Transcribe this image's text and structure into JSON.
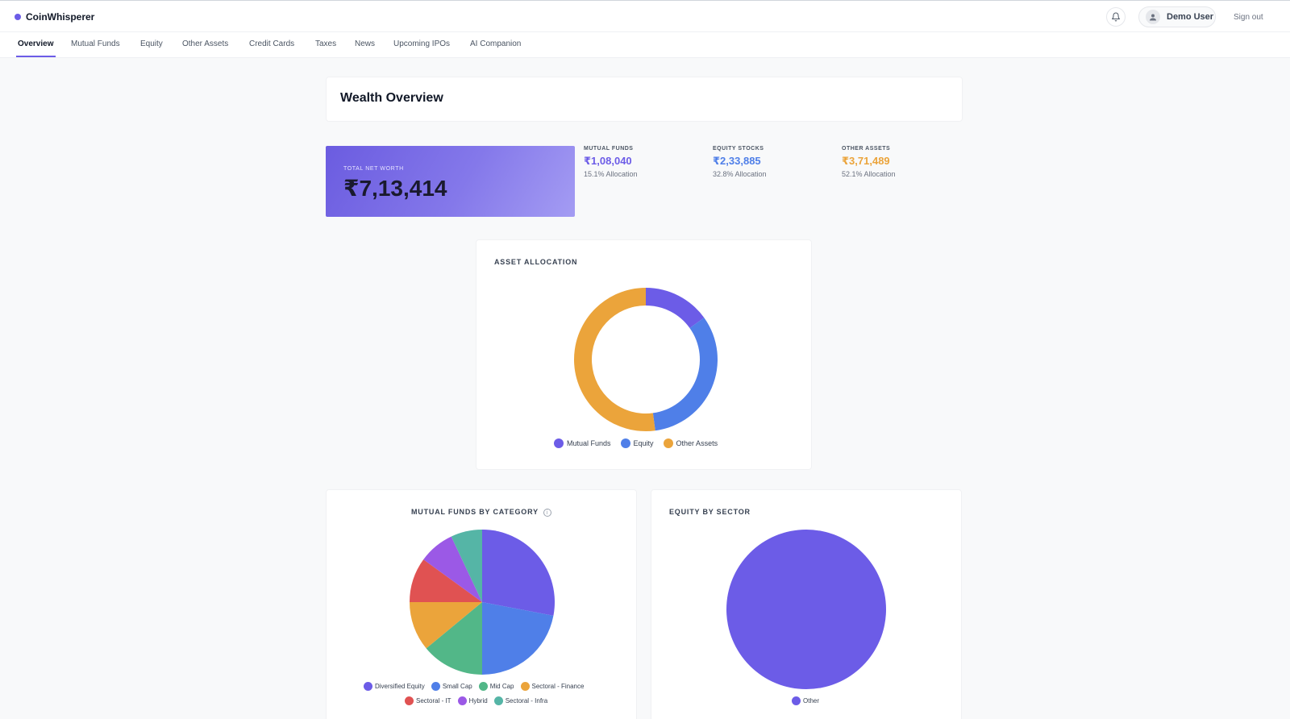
{
  "app": {
    "name": "CoinWhisperer"
  },
  "header": {
    "user_name": "Demo User",
    "signout_label": "Sign out"
  },
  "nav": {
    "tabs": [
      {
        "label": "Overview",
        "active": true
      },
      {
        "label": "Mutual Funds"
      },
      {
        "label": "Equity"
      },
      {
        "label": "Other Assets"
      },
      {
        "label": "Credit Cards"
      },
      {
        "label": "Taxes"
      },
      {
        "label": "News"
      },
      {
        "label": "Upcoming IPOs"
      },
      {
        "label": "AI Companion"
      }
    ]
  },
  "page": {
    "title": "Wealth Overview"
  },
  "networth": {
    "label": "TOTAL NET WORTH",
    "value": "₹7,13,414"
  },
  "stats": [
    {
      "label": "MUTUAL FUNDS",
      "value": "₹1,08,040",
      "allocation": "15.1% Allocation",
      "color": "#6c5ce7"
    },
    {
      "label": "EQUITY STOCKS",
      "value": "₹2,33,885",
      "allocation": "32.8% Allocation",
      "color": "#4f7fe8"
    },
    {
      "label": "OTHER ASSETS",
      "value": "₹3,71,489",
      "allocation": "52.1% Allocation",
      "color": "#eba43b"
    }
  ],
  "chart_data": [
    {
      "type": "pie",
      "variant": "donut",
      "title": "ASSET ALLOCATION",
      "categories": [
        "Mutual Funds",
        "Equity",
        "Other Assets"
      ],
      "values": [
        15.1,
        32.8,
        52.1
      ],
      "colors": [
        "#6c5ce7",
        "#4f7fe8",
        "#eba43b"
      ],
      "legend_position": "bottom"
    },
    {
      "type": "pie",
      "title": "MUTUAL FUNDS BY CATEGORY",
      "categories": [
        "Diversified Equity",
        "Small Cap",
        "Mid Cap",
        "Sectoral - Finance",
        "Sectoral - IT",
        "Hybrid",
        "Sectoral - Infra"
      ],
      "values": [
        28,
        22,
        14,
        11,
        10,
        8,
        7
      ],
      "colors": [
        "#6c5ce7",
        "#4f7fe8",
        "#52b788",
        "#eba43b",
        "#e05252",
        "#9b59e6",
        "#55b5a6"
      ],
      "legend_position": "bottom"
    },
    {
      "type": "pie",
      "title": "EQUITY BY SECTOR",
      "categories": [
        "Other"
      ],
      "values": [
        100
      ],
      "colors": [
        "#6c5ce7"
      ],
      "legend_position": "bottom"
    }
  ]
}
